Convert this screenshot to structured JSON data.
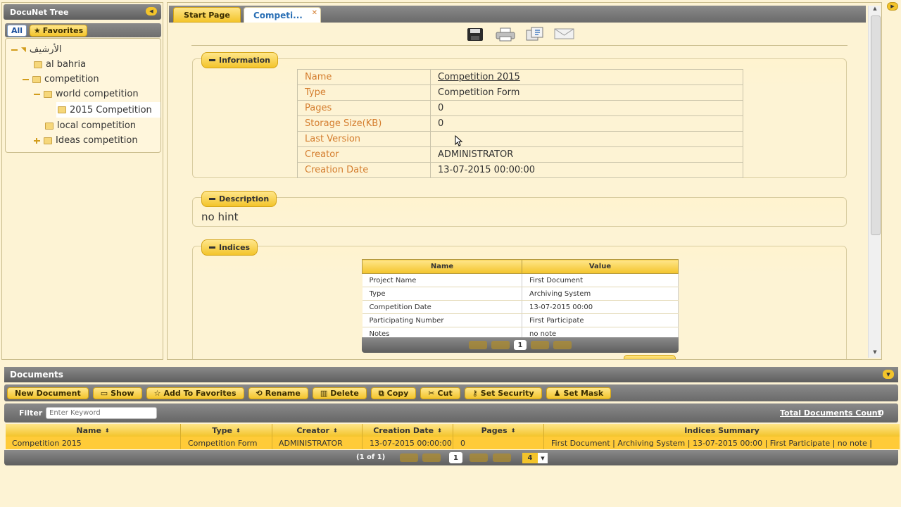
{
  "tree": {
    "title": "DocuNet Tree",
    "tabs": [
      "All",
      "Favorites"
    ],
    "items": [
      {
        "label": "الأرشيف"
      },
      {
        "label": "al bahria"
      },
      {
        "label": "competition"
      },
      {
        "label": "world competition"
      },
      {
        "label": "2015 Competition"
      },
      {
        "label": "local competition"
      },
      {
        "label": "Ideas competition"
      }
    ]
  },
  "tabs": [
    {
      "label": "Start Page"
    },
    {
      "label": "Competi..."
    }
  ],
  "toolbar_icons": [
    "save-icon",
    "print-icon",
    "copy-icon",
    "mail-icon"
  ],
  "information": {
    "legend": "Information",
    "rows": [
      {
        "key": "Name",
        "value": "Competition 2015"
      },
      {
        "key": "Type",
        "value": "Competition Form"
      },
      {
        "key": "Pages",
        "value": "0"
      },
      {
        "key": "Storage Size(KB)",
        "value": "0"
      },
      {
        "key": "Last Version",
        "value": ""
      },
      {
        "key": "Creator",
        "value": "ADMINISTRATOR"
      },
      {
        "key": "Creation Date",
        "value": "13-07-2015 00:00:00"
      }
    ]
  },
  "description": {
    "legend": "Description",
    "text": "no hint"
  },
  "indices": {
    "legend": "Indices",
    "headers": [
      "Name",
      "Value"
    ],
    "rows": [
      {
        "name": "Project Name",
        "value": "First Document"
      },
      {
        "name": "Type",
        "value": "Archiving System"
      },
      {
        "name": "Competition Date",
        "value": "13-07-2015 00:00"
      },
      {
        "name": "Participating Number",
        "value": "First Participate"
      },
      {
        "name": "Notes",
        "value": "no note"
      }
    ],
    "page": "1"
  },
  "documents": {
    "title": "Documents",
    "buttons": [
      "New Document",
      "Show",
      "Add To Favorites",
      "Rename",
      "Delete",
      "Copy",
      "Cut",
      "Set Security",
      "Set Mask"
    ],
    "filter_label": "Filter",
    "filter_placeholder": "Enter Keyword",
    "total_label": "Total Documents Count",
    "total_value": "0",
    "columns": [
      "Name",
      "Type",
      "Creator",
      "Creation Date",
      "Pages",
      "Indices Summary"
    ],
    "rows": [
      {
        "name": "Competition 2015",
        "type": "Competition Form",
        "creator": "ADMINISTRATOR",
        "date": "13-07-2015 00:00:00",
        "pages": "0",
        "summary": "First Document | Archiving System | 13-07-2015 00:00 | First Participate | no note |"
      }
    ],
    "pager_text": "(1 of 1)",
    "page": "1",
    "page_size": "4"
  }
}
